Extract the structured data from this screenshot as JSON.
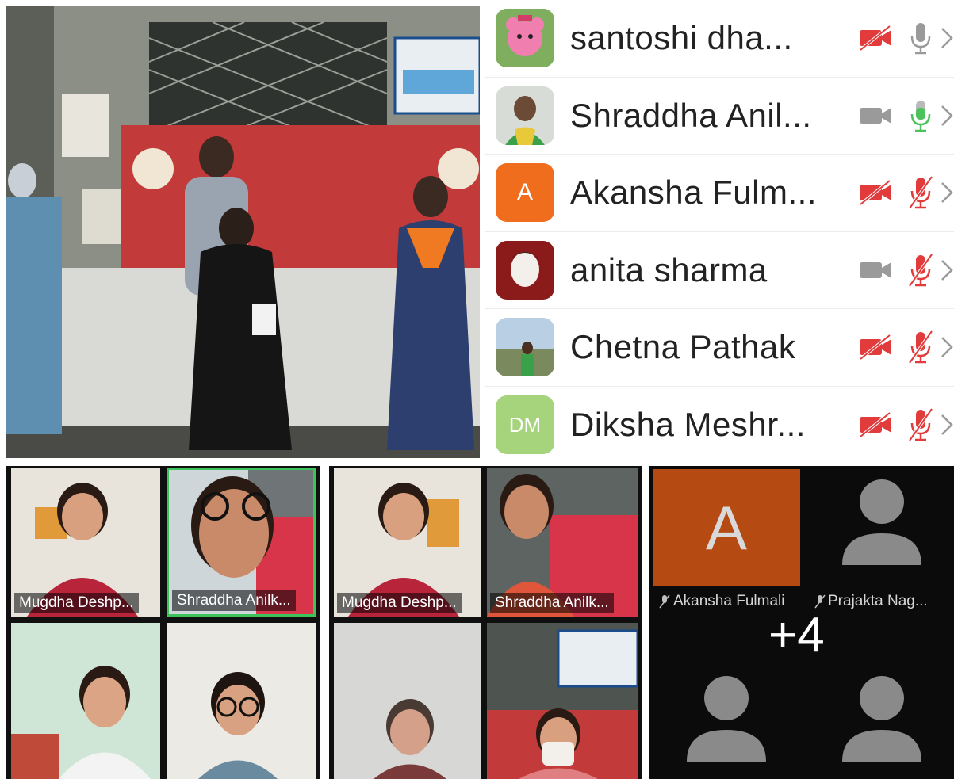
{
  "participants": [
    {
      "name": "santoshi dha...",
      "avatar": "teddy-bear-photo",
      "video": "off",
      "audio": "muted"
    },
    {
      "name": "Shraddha Anil...",
      "avatar": "woman-photo",
      "video": "on",
      "audio": "active"
    },
    {
      "name": "Akansha Fulm...",
      "avatar_initials": "A",
      "avatar_color": "#f06d1e",
      "video": "off",
      "audio": "off"
    },
    {
      "name": "anita sharma",
      "avatar": "woman-photo",
      "video": "on",
      "audio": "off"
    },
    {
      "name": "Chetna Pathak",
      "avatar": "outdoor-photo",
      "video": "off",
      "audio": "off"
    },
    {
      "name": "Diksha Meshr...",
      "avatar_initials": "DM",
      "avatar_color": "#a5d47c",
      "video": "off",
      "audio": "off"
    }
  ],
  "gallery_left": {
    "tiles": [
      {
        "label": "Mugdha Deshp..."
      },
      {
        "label": "Shraddha Anilk...",
        "active_speaker": true
      },
      {
        "label": ""
      },
      {
        "label": ""
      }
    ]
  },
  "gallery_middle": {
    "tiles": [
      {
        "label": "Mugdha Deshp..."
      },
      {
        "label": "Shraddha Anilk..."
      },
      {
        "label": ""
      },
      {
        "label": ""
      }
    ]
  },
  "gallery_right": {
    "tile_initial": "A",
    "names": [
      "Akansha Fulmali",
      "Prajakta Nag..."
    ],
    "more_count": "+4"
  },
  "colors": {
    "video_off_red": "#e23b3b",
    "video_on_gray": "#9a9a9a",
    "mic_active_green": "#4cc25a",
    "mic_off_red": "#e23b3b",
    "banner_red": "#c23a3a",
    "active_border": "#3cc35a"
  }
}
